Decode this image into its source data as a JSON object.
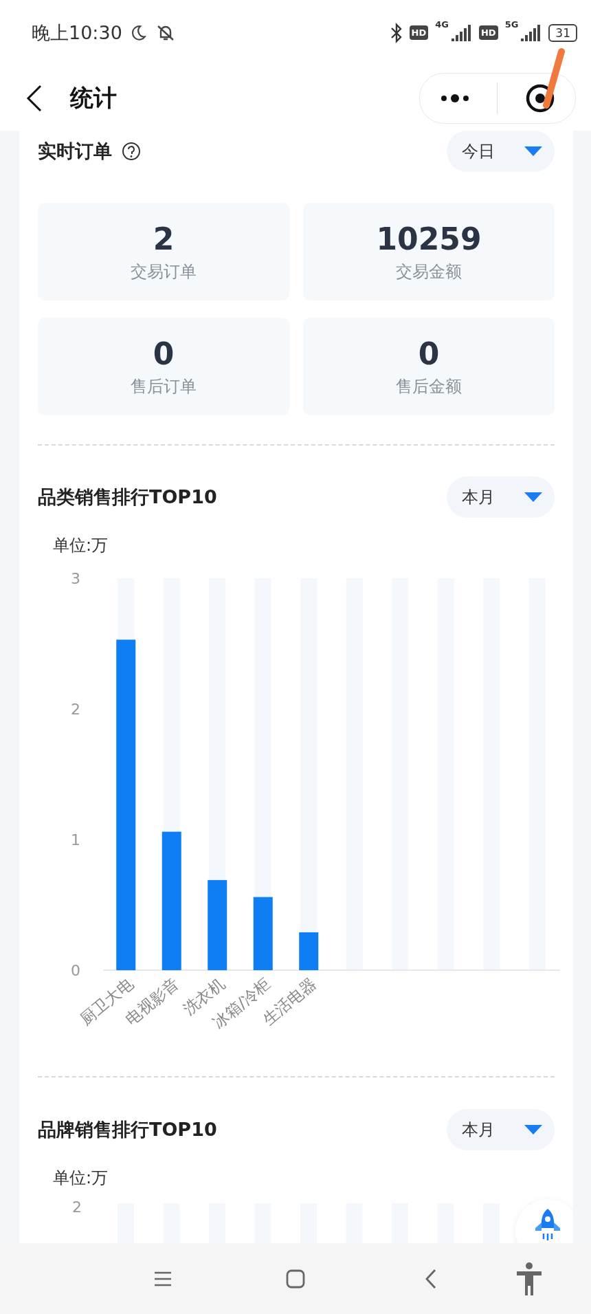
{
  "status_bar": {
    "time": "晚上10:30",
    "sim_badges": [
      "HD",
      "HD"
    ],
    "networks": [
      "4G",
      "5G"
    ],
    "battery": "31"
  },
  "nav": {
    "title": "统计"
  },
  "realtime": {
    "title": "实时订单",
    "period": "今日",
    "stats": [
      {
        "value": "2",
        "label": "交易订单"
      },
      {
        "value": "10259",
        "label": "交易金额"
      },
      {
        "value": "0",
        "label": "售后订单"
      },
      {
        "value": "0",
        "label": "售后金额"
      }
    ]
  },
  "category_ranking": {
    "title": "品类销售排行TOP10",
    "period": "本月",
    "unit": "单位:万",
    "chart_data": {
      "type": "bar",
      "categories": [
        "厨卫大电",
        "电视影音",
        "洗衣机",
        "冰箱/冷柜",
        "生活电器"
      ],
      "values": [
        2.53,
        1.06,
        0.69,
        0.56,
        0.29
      ],
      "ylim": [
        0,
        3
      ],
      "yticks": [
        0,
        1,
        2,
        3
      ]
    }
  },
  "brand_ranking": {
    "title": "品牌销售排行TOP10",
    "period": "本月",
    "unit": "单位:万",
    "top_tick": "2"
  }
}
